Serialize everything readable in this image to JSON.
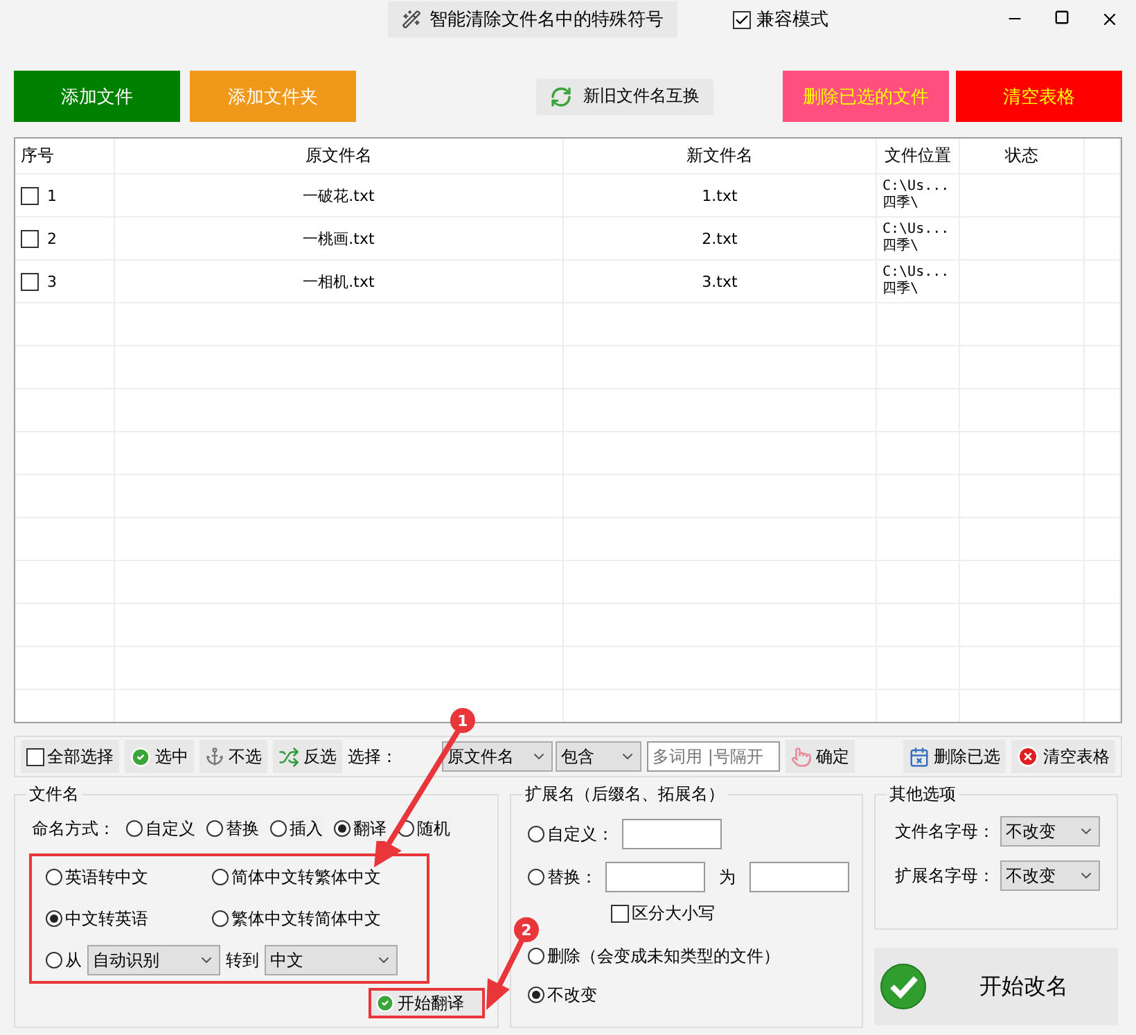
{
  "title_bar": {
    "app_button": "智能清除文件名中的特殊符号",
    "compat": {
      "label": "兼容模式",
      "checked": true
    }
  },
  "toolbar": {
    "left": [
      {
        "label": "添加文件",
        "kind": "add_file"
      },
      {
        "label": "添加文件夹",
        "kind": "add_folder"
      }
    ],
    "swap": "新旧文件名互换",
    "right": [
      {
        "label": "删除已选的文件",
        "kind": "delete_selected"
      },
      {
        "label": "清空表格",
        "kind": "clear_table"
      }
    ]
  },
  "table": {
    "columns": [
      "序号",
      "原文件名",
      "新文件名",
      "文件位置",
      "状态"
    ],
    "rows": [
      {
        "index": "1",
        "checked": false,
        "original": "一破花.txt",
        "new": "1.txt",
        "location": [
          "C:\\Us...",
          "四季\\"
        ]
      },
      {
        "index": "2",
        "checked": false,
        "original": "一桃画.txt",
        "new": "2.txt",
        "location": [
          "C:\\Us...",
          "四季\\"
        ]
      },
      {
        "index": "3",
        "checked": false,
        "original": "一相机.txt",
        "new": "3.txt",
        "location": [
          "C:\\Us...",
          "四季\\"
        ]
      }
    ]
  },
  "select_bar": {
    "select_all": {
      "label": "全部选择",
      "checked": false
    },
    "actions": [
      {
        "label": "选中",
        "kind": "check"
      },
      {
        "label": "不选",
        "kind": "anchor"
      },
      {
        "label": "反选",
        "kind": "shuffle"
      }
    ],
    "filter_label": "选择：",
    "field_value": "原文件名",
    "match_value": "包含",
    "keywords_placeholder": "多词用 |号隔开",
    "confirm": "确定",
    "right": [
      {
        "label": "删除已选",
        "kind": "delete"
      },
      {
        "label": "清空表格",
        "kind": "clear"
      }
    ]
  },
  "filename_group": {
    "title": "文件名",
    "mode_label": "命名方式：",
    "modes": [
      {
        "label": "自定义",
        "selected": false
      },
      {
        "label": "替换",
        "selected": false
      },
      {
        "label": "插入",
        "selected": false
      },
      {
        "label": "翻译",
        "selected": true
      },
      {
        "label": "随机",
        "selected": false
      }
    ],
    "translate_options": [
      {
        "label": "英语转中文",
        "selected": false
      },
      {
        "label": "简体中文转繁体中文",
        "selected": false
      },
      {
        "label": "中文转英语",
        "selected": true
      },
      {
        "label": "繁体中文转简体中文",
        "selected": false
      }
    ],
    "from_option": {
      "label": "从",
      "selected": false,
      "from_value": "自动识别",
      "to_label": "转到",
      "to_value": "中文"
    },
    "start_button": "开始翻译"
  },
  "extension_group": {
    "title": "扩展名（后缀名、拓展名）",
    "custom": {
      "label": "自定义：",
      "selected": false
    },
    "replace": {
      "label": "替换：",
      "selected": false,
      "between": "为"
    },
    "case_sensitive": {
      "label": "区分大小写",
      "checked": false
    },
    "delete": {
      "label": "删除（会变成未知类型的文件）",
      "selected": false
    },
    "unchanged": {
      "label": "不改变",
      "selected": true
    }
  },
  "other_group": {
    "title": "其他选项",
    "rows": [
      {
        "label": "文件名字母：",
        "value": "不改变"
      },
      {
        "label": "扩展名字母：",
        "value": "不改变"
      }
    ]
  },
  "rename_button": "开始改名",
  "annotations": [
    {
      "number": "1"
    },
    {
      "number": "2"
    }
  ]
}
